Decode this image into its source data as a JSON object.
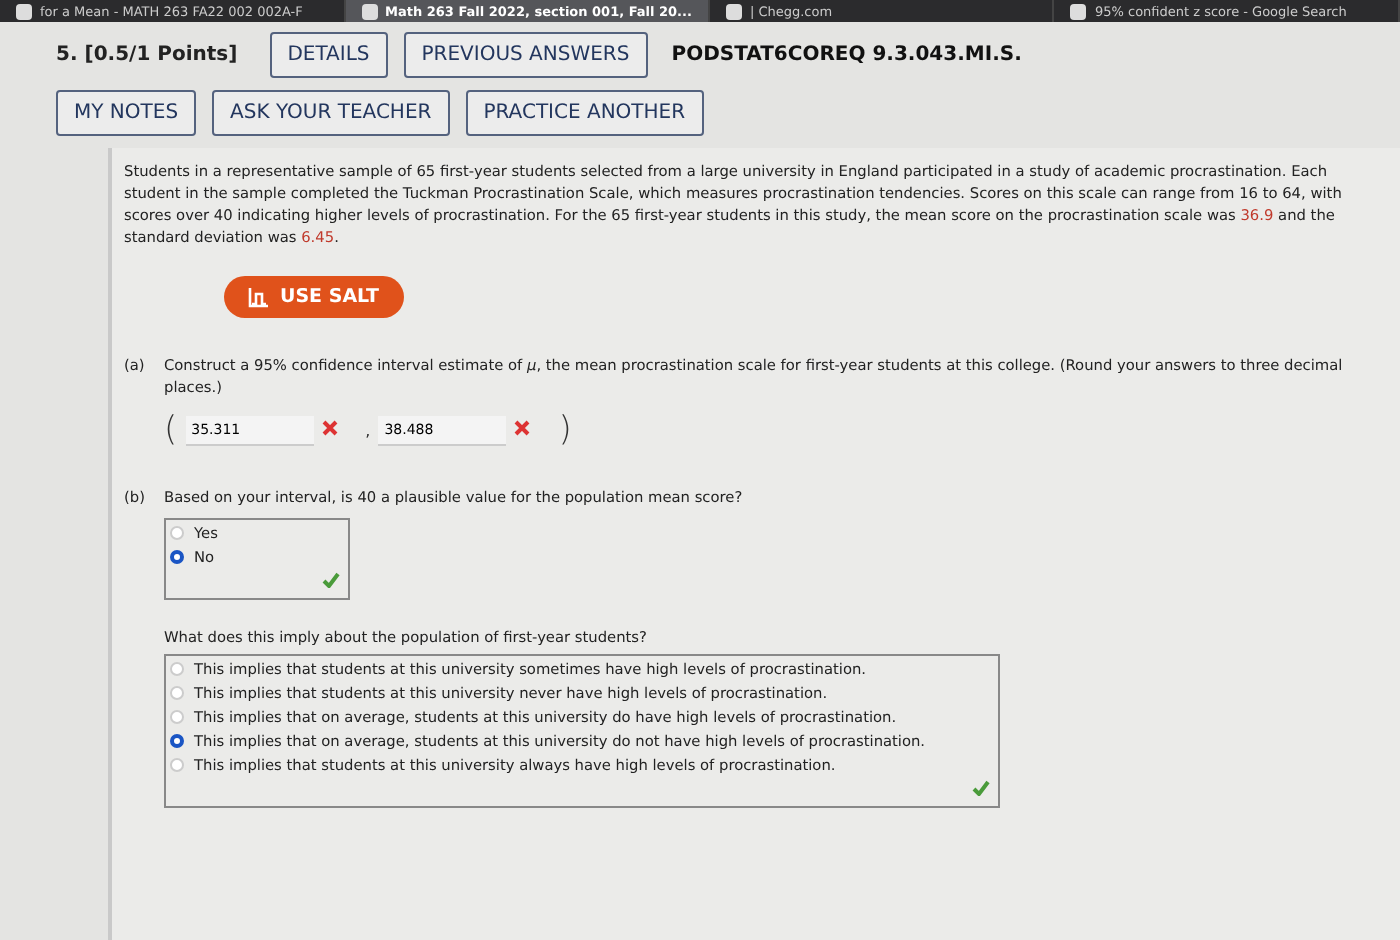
{
  "browser_tabs": [
    {
      "label": "for a Mean - MATH 263 FA22 002 002A-F",
      "selected": false
    },
    {
      "label": "Math 263 Fall 2022, section 001, Fall 20...",
      "selected": true
    },
    {
      "label": "| Chegg.com",
      "selected": false
    },
    {
      "label": "95% confident z score - Google Search",
      "selected": false
    }
  ],
  "question": {
    "number": "5.",
    "points": "[0.5/1 Points]",
    "buttons": [
      "DETAILS",
      "PREVIOUS ANSWERS"
    ],
    "code": "PODSTAT6COREQ 9.3.043.MI.S.",
    "actions": [
      "MY NOTES",
      "ASK YOUR TEACHER",
      "PRACTICE ANOTHER"
    ]
  },
  "prompt": [
    {
      "text": "Students in a representative sample of 65 first-year students selected from a large university in England participated in a study of academic procrastination. Each student in the sample completed the Tuckman Procrastination Scale, which measures procrastination tendencies. Scores on this scale can range from 16 to 64, with scores over 40 indicating higher levels of procrastination. For the 65 first-year students in this study, the mean score on the procrastination scale was ",
      "highlight": false
    },
    {
      "text": "36.9",
      "highlight": true
    },
    {
      "text": " and the standard deviation was ",
      "highlight": false
    },
    {
      "text": "6.45",
      "highlight": true
    },
    {
      "text": ".",
      "highlight": false
    }
  ],
  "salt_button": "USE SALT",
  "part_a": {
    "label": "(a)",
    "text": "Construct a 95% confidence interval estimate of *μ*, the mean procrastination scale for first-year students at this college. (Round your answers to three decimal places.)",
    "open": "(",
    "close": ")",
    "separator": ",",
    "answers": [
      {
        "value": "35.311",
        "correct": false
      },
      {
        "value": "38.488",
        "correct": false
      }
    ]
  },
  "part_b": {
    "label": "(b)",
    "text": "Based on your interval, is 40 a plausible value for the population mean score?",
    "options": [
      {
        "label": "Yes",
        "selected": false
      },
      {
        "label": "No",
        "selected": true
      }
    ],
    "correct": true,
    "followup": "What does this imply about the population of first-year students?",
    "followup_options": [
      {
        "label": "This implies that students at this university sometimes have high levels of procrastination.",
        "selected": false
      },
      {
        "label": "This implies that students at this university never have high levels of procrastination.",
        "selected": false
      },
      {
        "label": "This implies that on average, students at this university do have high levels of procrastination.",
        "selected": false
      },
      {
        "label": "This implies that on average, students at this university do not have high levels of procrastination.",
        "selected": true
      },
      {
        "label": "This implies that students at this university always have high levels of procrastination.",
        "selected": false
      }
    ],
    "followup_correct": true
  }
}
